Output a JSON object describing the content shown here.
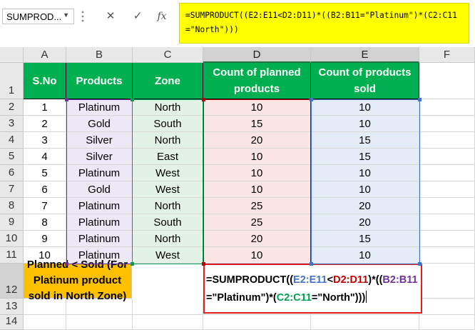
{
  "formula_bar": {
    "name_box": "SUMPROD...",
    "cancel_glyph": "✕",
    "enter_glyph": "✓",
    "fx_label": "fx",
    "formula": "=SUMPRODUCT((E2:E11<D2:D11)*((B2:B11=\"Platinum\")*(C2:C11=\"North\")))"
  },
  "columns": [
    "A",
    "B",
    "C",
    "D",
    "E",
    "F"
  ],
  "rows": [
    "1",
    "2",
    "3",
    "4",
    "5",
    "6",
    "7",
    "8",
    "9",
    "10",
    "11",
    "12",
    "13",
    "14"
  ],
  "headers": {
    "sno": "S.No",
    "products": "Products",
    "zone": "Zone",
    "planned": "Count of planned products",
    "sold": "Count of products sold"
  },
  "table": [
    {
      "sno": "1",
      "product": "Platinum",
      "zone": "North",
      "planned": "10",
      "sold": "10"
    },
    {
      "sno": "2",
      "product": "Gold",
      "zone": "South",
      "planned": "15",
      "sold": "10"
    },
    {
      "sno": "3",
      "product": "Silver",
      "zone": "North",
      "planned": "20",
      "sold": "15"
    },
    {
      "sno": "4",
      "product": "Silver",
      "zone": "East",
      "planned": "10",
      "sold": "15"
    },
    {
      "sno": "5",
      "product": "Platinum",
      "zone": "West",
      "planned": "10",
      "sold": "10"
    },
    {
      "sno": "6",
      "product": "Gold",
      "zone": "West",
      "planned": "10",
      "sold": "10"
    },
    {
      "sno": "7",
      "product": "Platinum",
      "zone": "North",
      "planned": "25",
      "sold": "20"
    },
    {
      "sno": "8",
      "product": "Platinum",
      "zone": "South",
      "planned": "25",
      "sold": "20"
    },
    {
      "sno": "9",
      "product": "Platinum",
      "zone": "North",
      "planned": "20",
      "sold": "15"
    },
    {
      "sno": "10",
      "product": "Platinum",
      "zone": "West",
      "planned": "10",
      "sold": "10"
    }
  ],
  "result_label": "Planned < Sold (For Platinum product sold in North Zone)",
  "edit_formula": {
    "prefix": "=SUMPRODUCT((",
    "ref_e": "E2:E11",
    "lt": "<",
    "ref_d": "D2:D11",
    "mid1": ")*((",
    "ref_b": "B2:B11",
    "mid2": "=\"Platinum\")*(",
    "ref_c": "C2:C11",
    "suffix": "=\"North\")))"
  },
  "colors": {
    "header_green": "#00b050",
    "label_orange": "#ffc000",
    "formula_yellow": "#ffff00",
    "edit_border": "#e02020",
    "ref_e": "#4472c4",
    "ref_d": "#c00000",
    "ref_b": "#7030a0",
    "ref_c": "#00a050"
  }
}
